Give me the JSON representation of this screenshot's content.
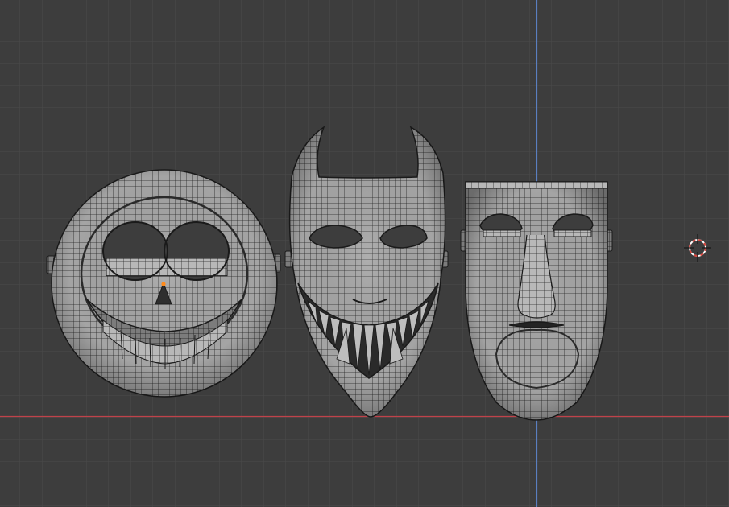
{
  "viewport": {
    "mode": "3d-viewport-wireframe-overlay",
    "background_color": "#3d3d3d",
    "grid_color": "#4a4a4a",
    "x_axis_color": "#c0424a",
    "z_axis_color": "#5a7fc0",
    "mesh_color": "#9a9a9a",
    "wire_color": "#1e1e1e",
    "selected_vertex_color": "#ff8a1a",
    "cursor_color": "#d8443c"
  },
  "objects": [
    {
      "name": "skull-mask",
      "icon": "skull-mask-icon"
    },
    {
      "name": "horned-grin-mask",
      "icon": "horned-mask-icon"
    },
    {
      "name": "long-face-mask",
      "icon": "long-face-mask-icon"
    }
  ],
  "cursor": {
    "icon": "3d-cursor-icon"
  }
}
